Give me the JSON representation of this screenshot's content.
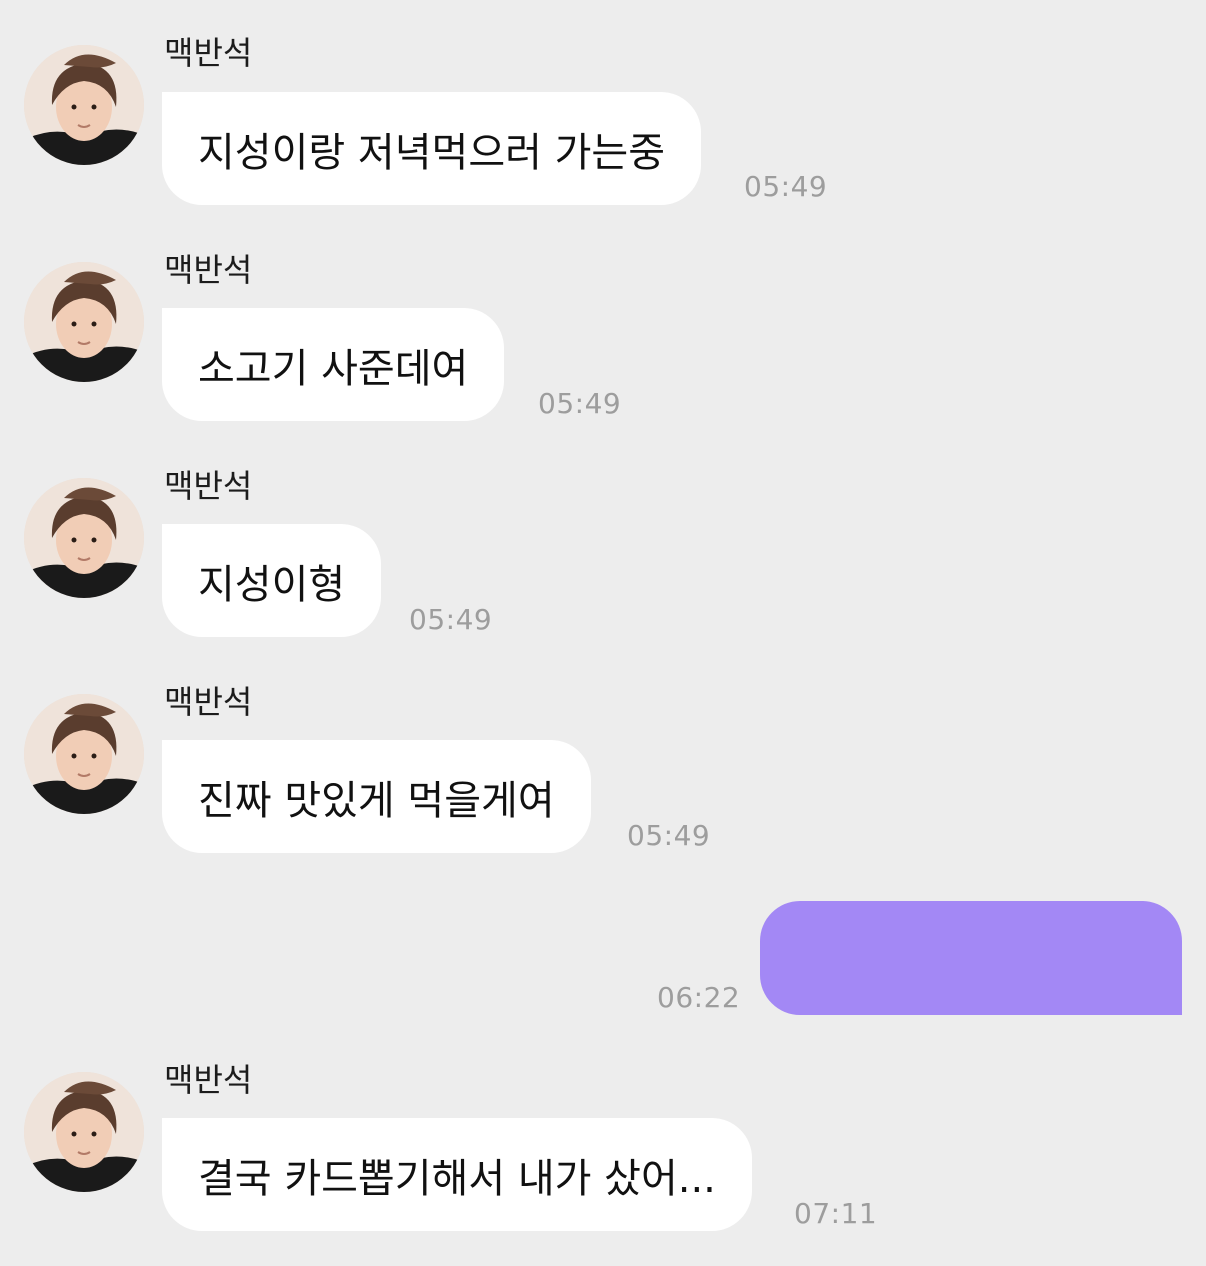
{
  "messages": [
    {
      "type": "received",
      "sender": "맥반석",
      "text": "지성이랑 저녁먹으러 가는중",
      "time": "05:49"
    },
    {
      "type": "received",
      "sender": "맥반석",
      "text": "소고기 사준데여",
      "time": "05:49"
    },
    {
      "type": "received",
      "sender": "맥반석",
      "text": "지성이형",
      "time": "05:49"
    },
    {
      "type": "received",
      "sender": "맥반석",
      "text": "진짜 맛있게 먹을게여",
      "time": "05:49"
    },
    {
      "type": "sent",
      "text": "",
      "time": "06:22",
      "bubble_color": "#a388f5"
    },
    {
      "type": "received",
      "sender": "맥반석",
      "text": "결국 카드뽑기해서 내가 샀어...",
      "time": "07:11"
    }
  ],
  "colors": {
    "background": "#ededed",
    "received_bubble": "#ffffff",
    "sent_bubble": "#a388f5",
    "time_text": "#9d9d9d"
  },
  "icons": {
    "avatar": "profile-photo"
  }
}
